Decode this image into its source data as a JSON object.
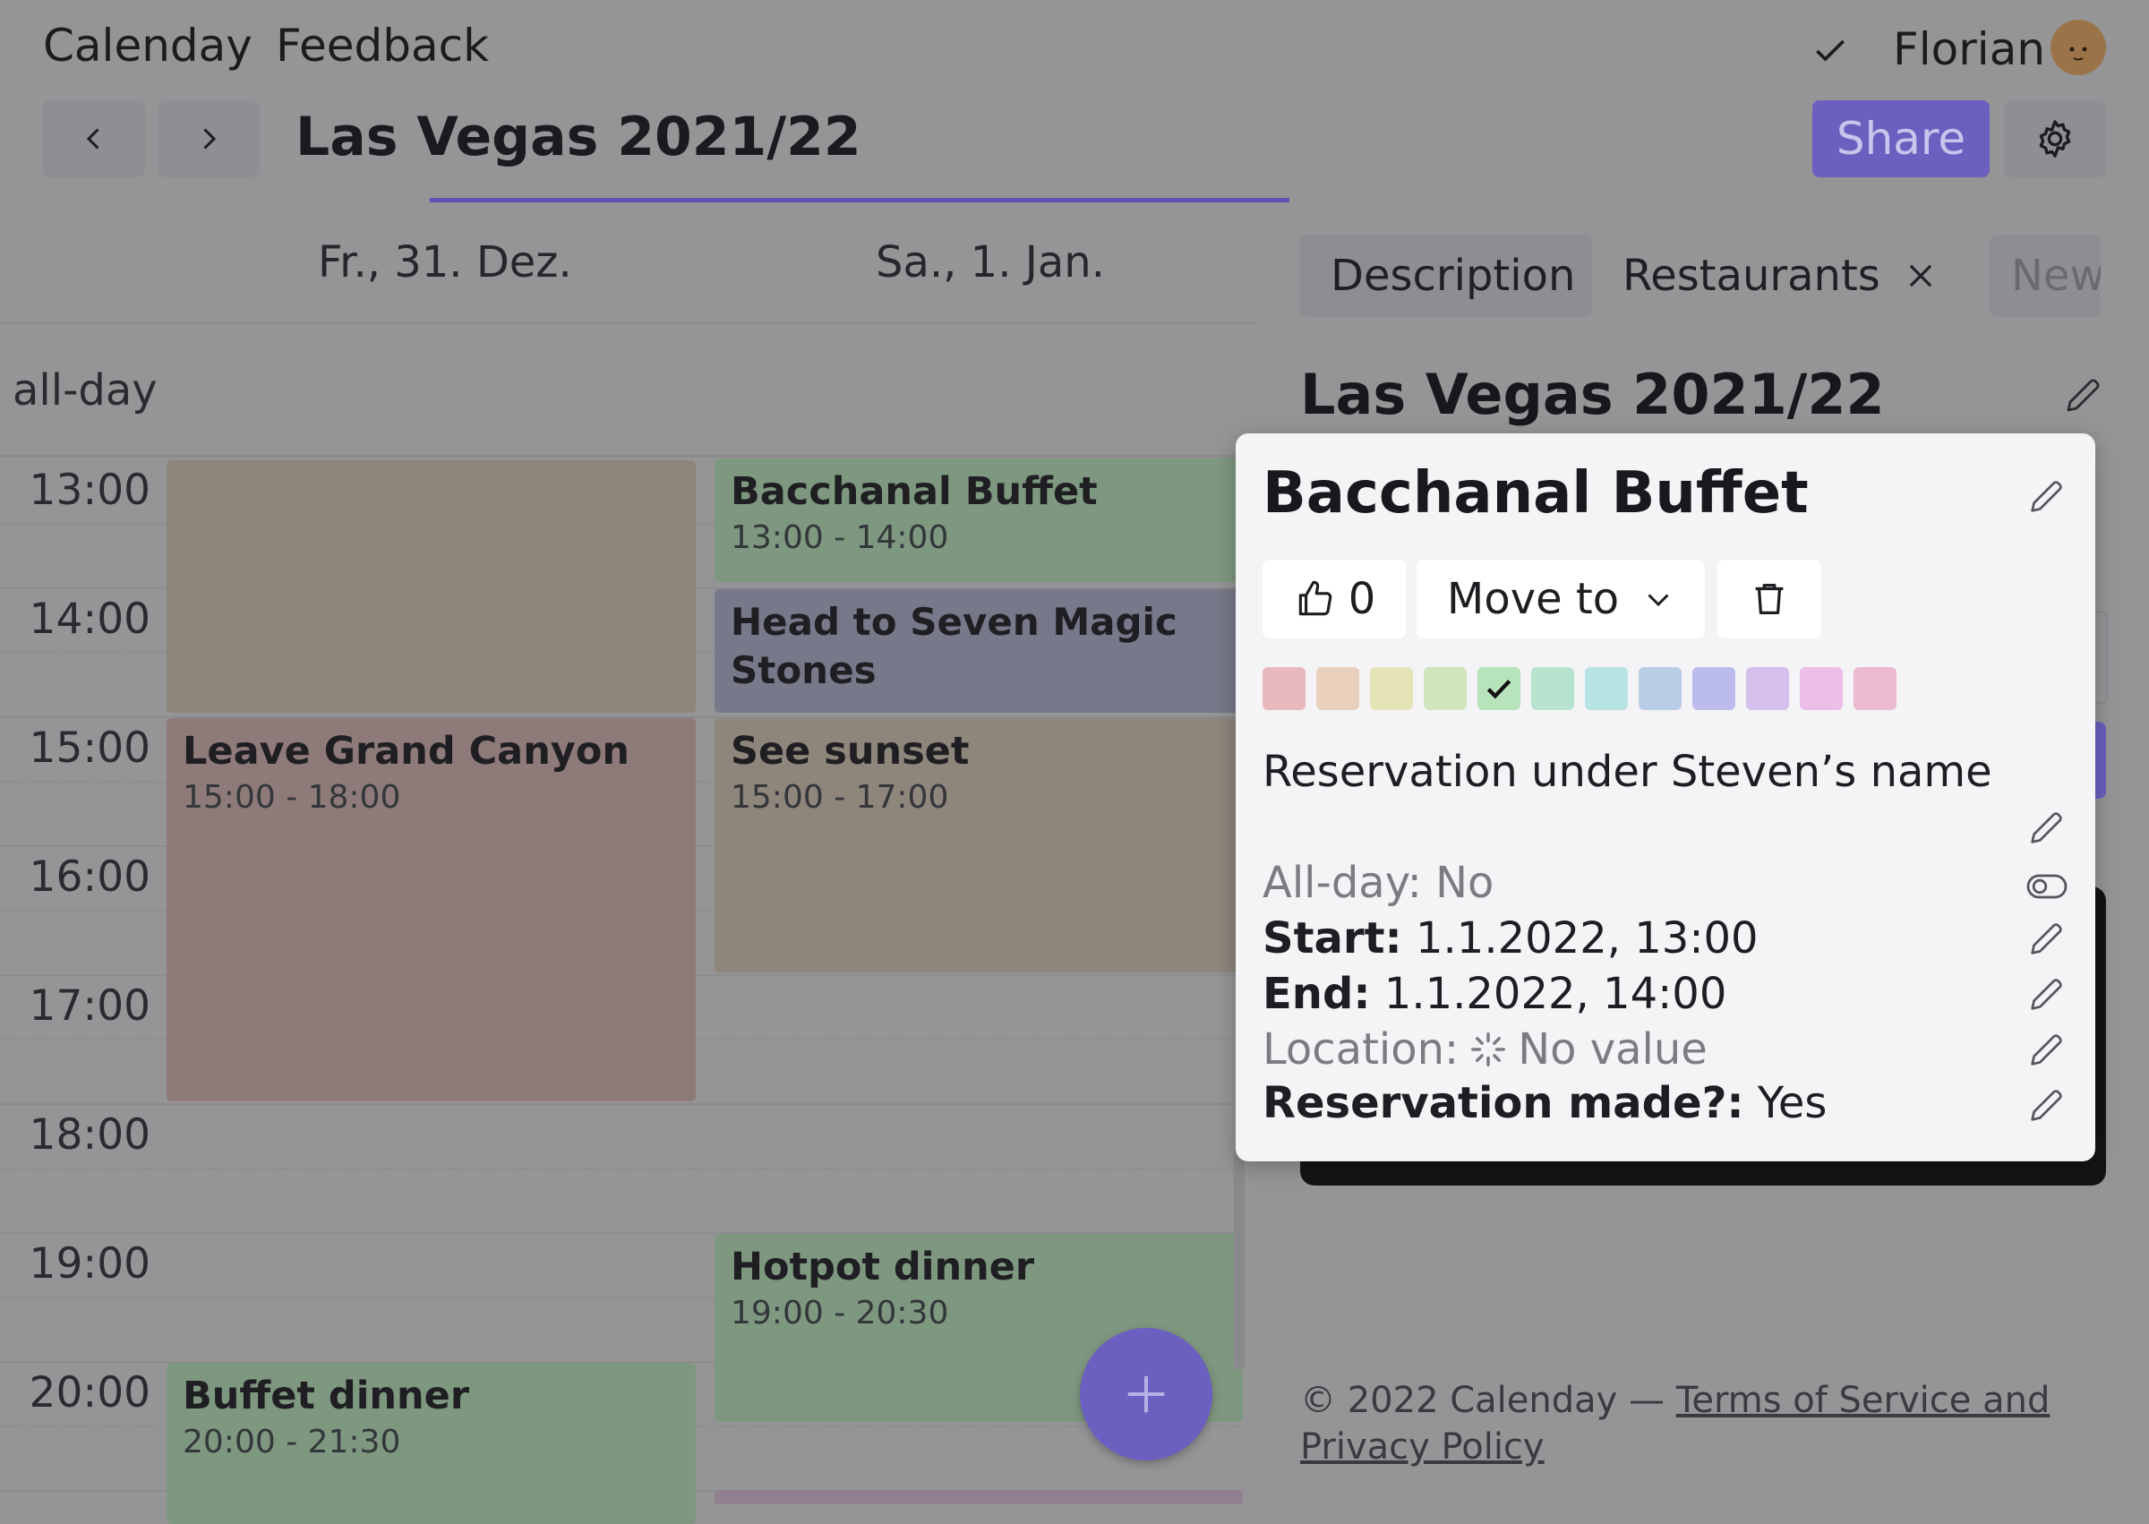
{
  "nav": {
    "app_link": "Calenday",
    "feedback_link": "Feedback"
  },
  "user": {
    "name": "Florian"
  },
  "header": {
    "title": "Las Vegas 2021/22",
    "share_label": "Share"
  },
  "calendar": {
    "days": [
      "Fr., 31. Dez.",
      "Sa., 1. Jan."
    ],
    "allday_label": "all-day",
    "hours": [
      "13:00",
      "14:00",
      "15:00",
      "16:00",
      "17:00",
      "18:00",
      "19:00",
      "20:00"
    ],
    "events": [
      {
        "title": "Bacchanal Buffet",
        "time": "13:00 - 14:00"
      },
      {
        "title": "Head to Seven Magic Stones",
        "time": ""
      },
      {
        "title": "Leave Grand Canyon",
        "time": "15:00 - 18:00"
      },
      {
        "title": "See sunset",
        "time": "15:00 - 17:00"
      },
      {
        "title": "Hotpot dinner",
        "time": "19:00 - 20:30"
      },
      {
        "title": "Buffet dinner",
        "time": "20:00 - 21:30"
      }
    ]
  },
  "panel": {
    "tabs": [
      "Description",
      "Restaurants",
      "New"
    ],
    "title": "Las Vegas 2021/22"
  },
  "footer": {
    "text": "© 2022 Calenday — ",
    "link": "Terms of Service and Privacy Policy"
  },
  "popover": {
    "title": "Bacchanal Buffet",
    "likes": "0",
    "move_label": "Move to",
    "description": "Reservation under Steven’s name",
    "swatches": [
      "#e8b9bd",
      "#e9d0bd",
      "#e4e4b7",
      "#cfe6bd",
      "#b8e4bc",
      "#b6e4cf",
      "#b7e3e3",
      "#bacde6",
      "#bcbcec",
      "#d6c0eb",
      "#ecbde6",
      "#ebbad0"
    ],
    "selected_swatch": 4,
    "props": {
      "allday_key": "All-day:",
      "allday_val": "No",
      "start_key": "Start:",
      "start_val": "1.1.2022, 13:00",
      "end_key": "End:",
      "end_val": "1.1.2022, 14:00",
      "location_key": "Location:",
      "location_val": "No value",
      "reservation_key": "Reservation made?:",
      "reservation_val": "Yes"
    }
  },
  "colors": {
    "accent": "#6b5fbf",
    "green_event": "#7e977f",
    "pink_event": "#8f7a7a",
    "tan_event": "#8e857b",
    "purple_event": "#777889"
  }
}
